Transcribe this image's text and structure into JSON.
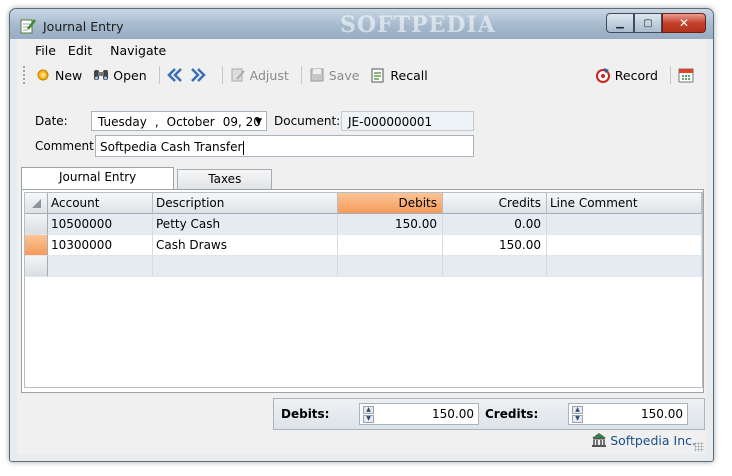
{
  "window": {
    "title": "Journal Entry",
    "watermark": "SOFTPEDIA"
  },
  "menu": [
    "File",
    "Edit",
    "Navigate"
  ],
  "toolbar": {
    "new_label": "New",
    "open_label": "Open",
    "adjust_label": "Adjust",
    "save_label": "Save",
    "recall_label": "Recall",
    "record_label": "Record"
  },
  "form": {
    "date_label": "Date:",
    "date_weekday": "Tuesday",
    "date_sep": ",",
    "date_month": "October",
    "date_day_year": "09, 20",
    "document_label": "Document:",
    "document_value": "JE-000000001",
    "comment_label": "Comment:",
    "comment_value": "Softpedia Cash Transfer"
  },
  "tabs": [
    "Journal Entry",
    "Taxes"
  ],
  "grid": {
    "columns": [
      "Account",
      "Description",
      "Debits",
      "Credits",
      "Line Comment"
    ],
    "rows": [
      {
        "account": "10500000",
        "description": "Petty Cash",
        "debits": "150.00",
        "credits": "0.00",
        "comment": ""
      },
      {
        "account": "10300000",
        "description": "Cash Draws",
        "debits": "",
        "credits": "150.00",
        "comment": ""
      }
    ]
  },
  "totals": {
    "debits_label": "Debits:",
    "debits_value": "150.00",
    "credits_label": "Credits:",
    "credits_value": "150.00"
  },
  "footer": {
    "company": "Softpedia Inc."
  },
  "colors": {
    "sorted_header": "#f59a5b",
    "link": "#1a4f86"
  }
}
